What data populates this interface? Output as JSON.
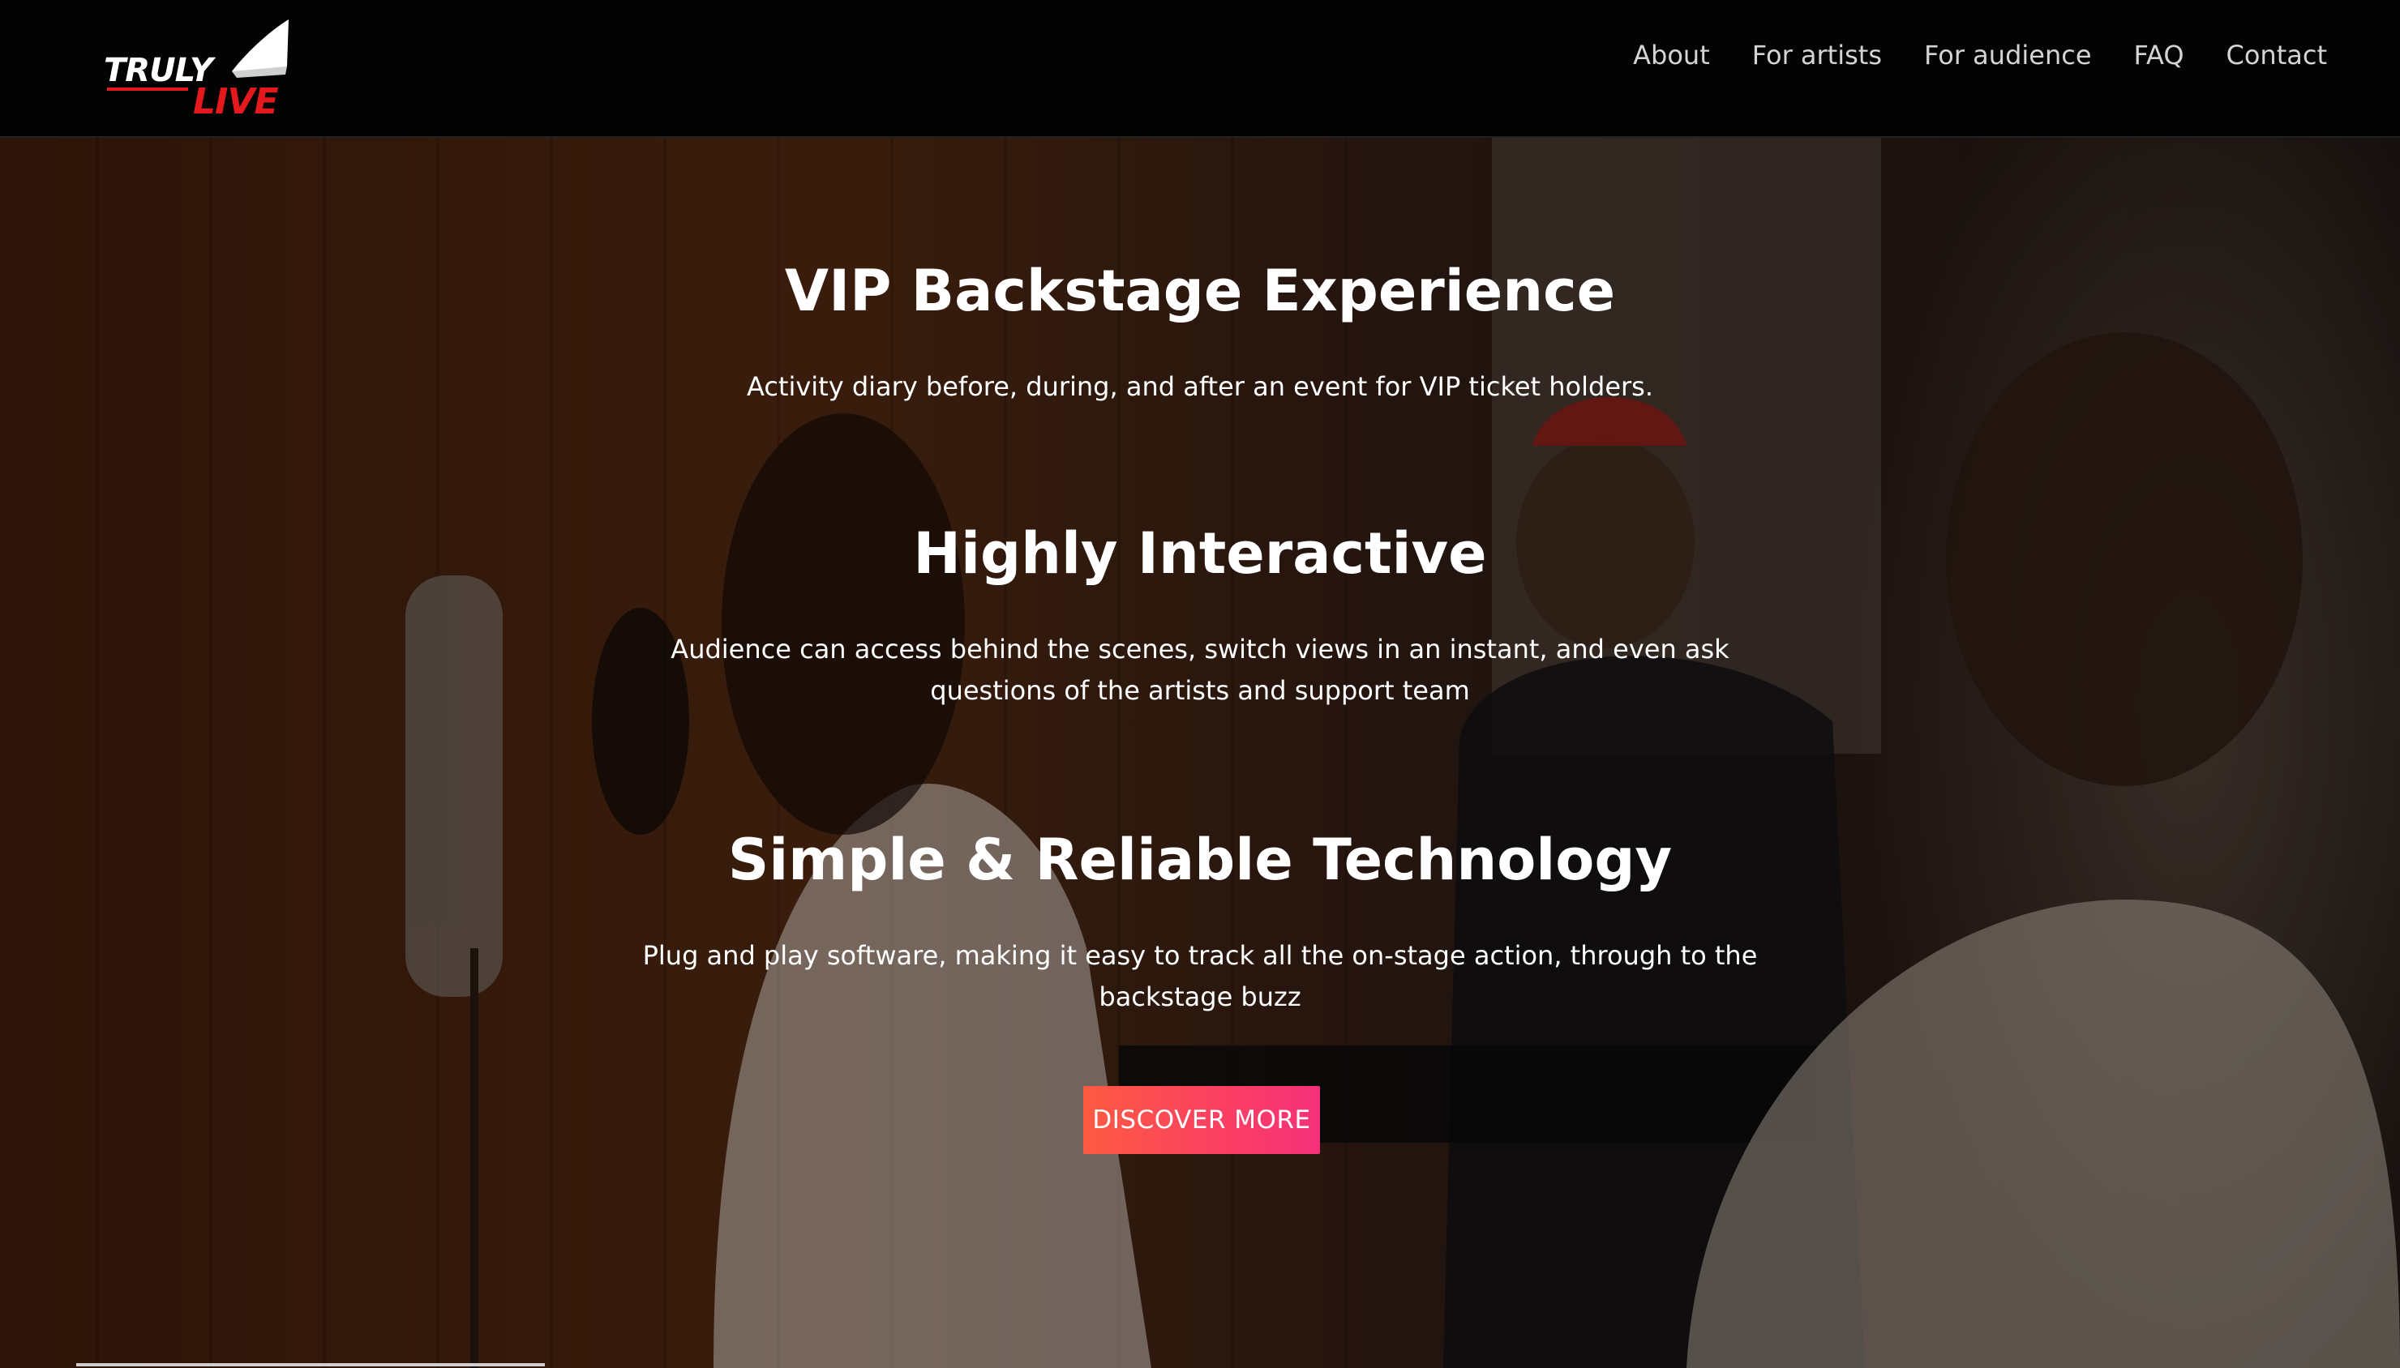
{
  "brand": {
    "logo_text_1": "TRULY",
    "logo_text_2": "LIVE",
    "accent_color": "#e3191e"
  },
  "nav": {
    "items": [
      {
        "label": "About"
      },
      {
        "label": "For artists"
      },
      {
        "label": "For audience"
      },
      {
        "label": "FAQ"
      },
      {
        "label": "Contact"
      }
    ]
  },
  "hero": {
    "sections": [
      {
        "title": "VIP Backstage Experience",
        "text": "Activity diary before, during, and after an event for VIP ticket holders."
      },
      {
        "title": "Highly Interactive",
        "text": "Audience can access behind the scenes, switch views in an instant, and even ask questions of the artists and support team"
      },
      {
        "title": "Simple & Reliable Technology",
        "text": "Plug and play software, making it easy to track all the on-stage action, through to the backstage buzz"
      }
    ],
    "cta_label": "DISCOVER MORE",
    "cta_gradient": [
      "#fc5a41",
      "#f5307a"
    ]
  }
}
